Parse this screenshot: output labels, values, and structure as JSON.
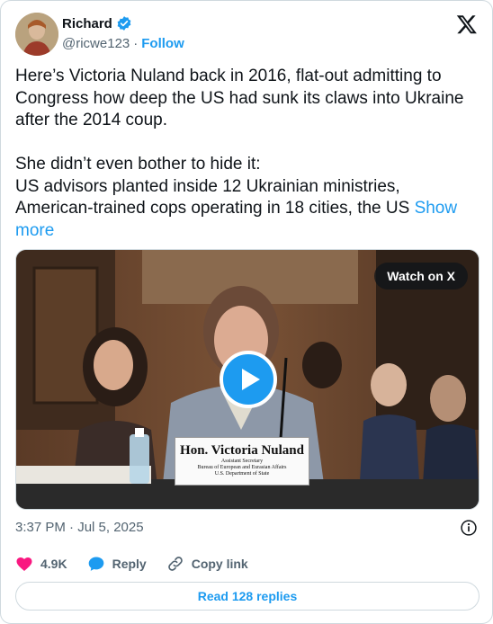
{
  "author": {
    "name": "Richard",
    "handle": "@ricwe123",
    "separator": "·",
    "follow_label": "Follow"
  },
  "tweet": {
    "text_main": "Here’s Victoria Nuland back in 2016, flat-out admitting to Congress how deep the US had sunk its claws into Ukraine after the 2014 coup.\n\nShe didn’t even bother to hide it:\nUS advisors planted inside 12 Ukrainian ministries, American-trained cops operating in 18 cities, the US ",
    "show_more_label": "Show more"
  },
  "media": {
    "watch_label": "Watch on X",
    "nameplate": {
      "title": "Hon. Victoria Nuland",
      "line1": "Assistant Secretary",
      "line2": "Bureau of European and Eurasian Affairs",
      "line3": "U.S. Department of State"
    }
  },
  "meta": {
    "timestamp": "3:37 PM · Jul 5, 2025"
  },
  "actions": {
    "like_count": "4.9K",
    "reply_label": "Reply",
    "copy_label": "Copy link"
  },
  "footer": {
    "read_replies_label": "Read 128 replies"
  },
  "colors": {
    "accent": "#1d9bf0",
    "like": "#f91880",
    "text": "#0f1419",
    "secondary": "#536471"
  },
  "icons": [
    "verified-badge-icon",
    "x-logo-icon",
    "play-icon",
    "info-icon",
    "heart-icon",
    "reply-icon",
    "link-icon"
  ]
}
